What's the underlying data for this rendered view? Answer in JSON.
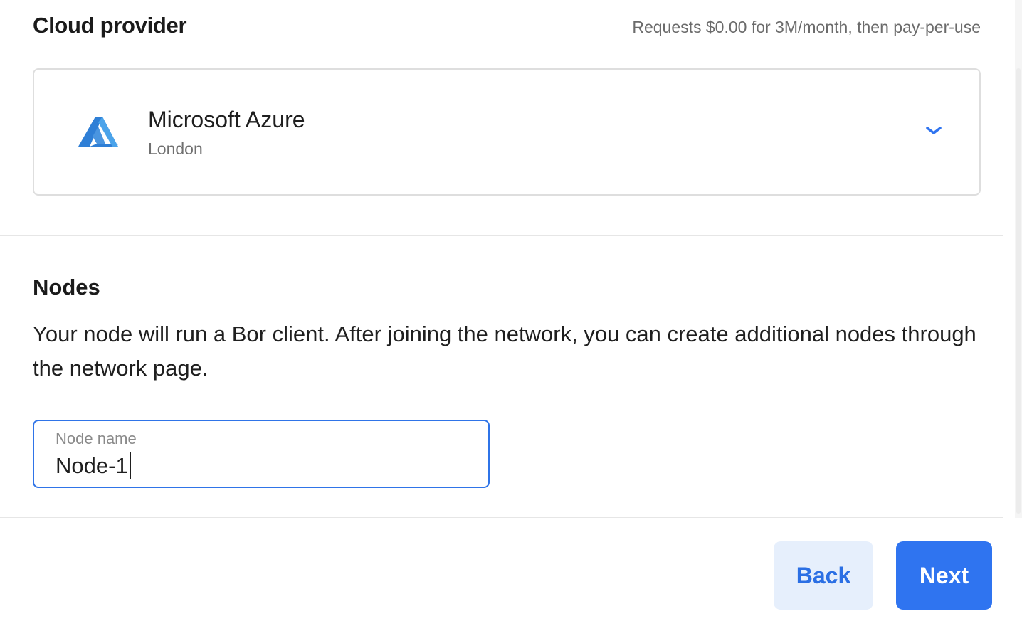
{
  "cloud_provider": {
    "title": "Cloud provider",
    "pricing_note": "Requests $0.00 for 3M/month, then pay-per-use",
    "selected": {
      "name": "Microsoft Azure",
      "region": "London",
      "logo_icon": "azure-logo-icon",
      "dropdown_icon": "chevron-down-icon"
    }
  },
  "nodes": {
    "title": "Nodes",
    "description": "Your node will run a Bor client. After joining the network, you can create additional nodes through the network page.",
    "node_name_field": {
      "label": "Node name",
      "value": "Node-1"
    }
  },
  "footer": {
    "back_label": "Back",
    "next_label": "Next"
  },
  "colors": {
    "accent": "#2f74f0",
    "accent_light": "#e6effc",
    "azure_blue": "#2f7fd6"
  }
}
